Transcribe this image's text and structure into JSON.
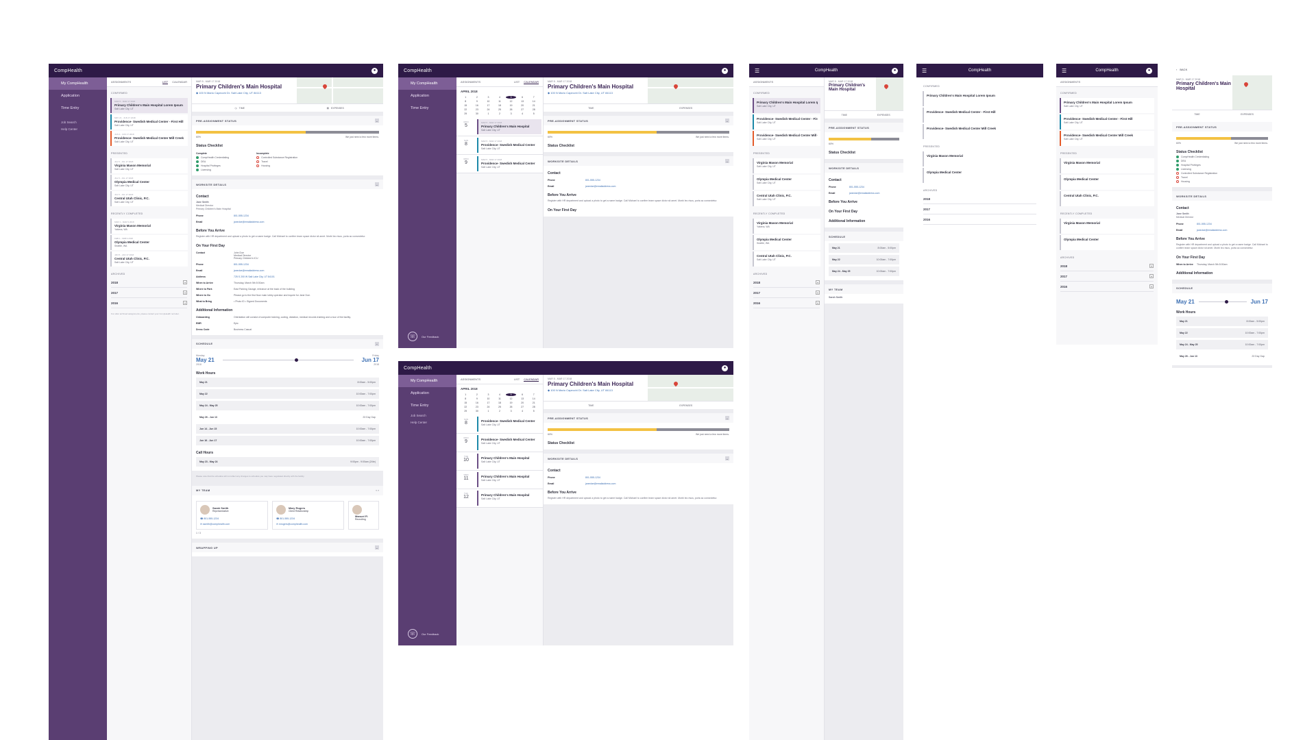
{
  "app": {
    "brand": "CompHealth"
  },
  "nav": {
    "items": [
      "My CompHealth",
      "Application",
      "Time Entry"
    ],
    "sub": [
      "Job Search",
      "Help Center"
    ],
    "contact": "Our Feedback"
  },
  "list": {
    "header": "ASSIGNMENTS",
    "tab_list": "LIST",
    "tab_calendar": "CALENDAR",
    "confirmed": "CONFIRMED",
    "presented": "PRESENTED",
    "recent": "RECENTLY COMPLETED",
    "archived": "ARCHIVED",
    "years": [
      "2018",
      "2017",
      "2016"
    ],
    "archive_note": "For older archived assignments, please contact your CompHealth recruiter.",
    "cards": [
      {
        "date": "MAR 5 - MAR 17 2018",
        "title": "Primary Children's Main Hospital Lorem Ipsum",
        "sub": "Salt Lake City, UT"
      },
      {
        "date": "MAY 21 - JUN 17 2018",
        "title": "Providence- Swedish Medical Center - First Hill",
        "sub": "Salt Lake City, UT"
      },
      {
        "date": "JUN 4 - JUN 17 2018",
        "title": "Providence- Swedish Medical Center Mill Creek",
        "sub": "Salt Lake City, UT"
      }
    ],
    "presented_cards": [
      {
        "date": "JUL 5 - JUL 17 2018",
        "title": "Virginia Mason Memorial",
        "sub": "Salt Lake City, UT"
      },
      {
        "date": "JUL 5 - JUL 17 2018",
        "title": "Olympia Medical Center",
        "sub": "Salt Lake City, UT"
      },
      {
        "date": "JUL 5 - JUL 17 2018",
        "title": "Central Utah Clinic, P.C.",
        "sub": "Salt Lake City, UT"
      }
    ],
    "recent_cards": [
      {
        "date": "MAR 1 - MAR 9 2018",
        "title": "Virginia Mason Memorial",
        "sub": "Yakima, WA"
      },
      {
        "date": "FEB 1 - FEB 9 2018",
        "title": "Olympia Medical Center",
        "sub": "Seattle, WA"
      },
      {
        "date": "JAN 5 - JAN 17 2018",
        "title": "Central Utah Clinic, P.C.",
        "sub": "Salt Lake City, UT"
      }
    ]
  },
  "detail": {
    "date": "MAR 5 - MAR 17 2018",
    "title": "Primary Children's Main Hospital",
    "address": "100 N Mario Capecchi Dr. Salt Lake City, UT 84113",
    "tab_time": "TIME",
    "tab_expenses": "EXPENSES",
    "pre_status": "PRE-ASSIGNMENT STATUS",
    "progress_label": "60%",
    "progress_value": 0.6,
    "progress_note": "We just need a few more items.",
    "checklist_title": "Status Checklist",
    "complete_label": "Complete",
    "incomplete_label": "Incomplete",
    "complete": [
      "CompHealth Credentialing",
      "DEA",
      "Hospital Privileges",
      "Licensing"
    ],
    "incomplete": [
      "Controlled Substance Registration",
      "Travel",
      "Housing"
    ],
    "worksite": "WORKSITE DETAILS",
    "contact_h": "Contact",
    "contact_name": "Jane Smith",
    "contact_role": "Medical Director",
    "contact_org": "Primary Children's Main Hospital",
    "phone_k": "Phone",
    "phone_v": "801-555-1234",
    "email_k": "Email",
    "email_v": "janedoe@emailaddress.com",
    "before_h": "Before You Arrive",
    "before_p": "Register with HR department and upload a photo to get a name badge. Call Michael to confirm team space dictor sit amet. Morbi leo risus, porta ac consectetur.",
    "first_h": "On Your First Day",
    "first_contact": "John Doe",
    "first_role": "Medical Director",
    "first_org": "Primary Children's ICU",
    "address_k": "Address",
    "address_v": "725 S 200 W Salt Lake City, UT 84101",
    "arrive_k": "When to Arrive",
    "arrive_v": "Thursday, March 5th 8:00am",
    "park_k": "Where to Park",
    "park_v": "East Parking Garage, entrance at the back of the building",
    "go_k": "Where to Go",
    "go_v": "Please go to the first floor main lobby operator and inquire for Jane Doe.",
    "bring_k": "What to Bring",
    "bring_v": "• Photo ID  • Signed Documents",
    "addl_h": "Additional Information",
    "onb_k": "Onboarding",
    "onb_v": "Orientation will consist of computer training, coding, dictation, medical records training and a tour of the facility.",
    "emr_k": "EMR",
    "emr_v": "Epic",
    "dress_k": "Dress Code",
    "dress_v": "Business Casual",
    "schedule": "SCHEDULE",
    "start_day": "Monday",
    "start": "May 21",
    "start_year": "2018",
    "end_day": "Friday",
    "end": "Jun 17",
    "end_year": "2018",
    "work_hours": "Work Hours",
    "rows": [
      {
        "d": "May 21",
        "h": "8:00am - 5:00pm"
      },
      {
        "d": "May 22",
        "h": "10:00am - 7:00pm"
      },
      {
        "d": "May 24 - May 25",
        "h": "10:00am - 7:00pm"
      },
      {
        "d": "May 26 - Jun 13",
        "h": "23 Day Gap"
      },
      {
        "d": "Jun 14 - Jun 15",
        "h": "10:00am - 7:00pm"
      },
      {
        "d": "Jun 16 - Jun 17",
        "h": "10:00am - 7:00pm"
      }
    ],
    "call_hours": "Call Hours",
    "call_row": {
      "d": "May 23 - May 24",
      "h": "9:00pm - 9:00am (24hr)"
    },
    "sched_note": "Please note that the schedule will not reflect any changes to schedule you may have negotiated directly with the facility.",
    "my_team": "MY TEAM",
    "team": [
      {
        "name": "Sarah Smith",
        "role": "Representative",
        "phone": "801-555-1234",
        "email": "ssmith@comphealth.com"
      },
      {
        "name": "Mary Rogers",
        "role": "Client Relationship",
        "phone": "801-555-1234",
        "email": "mrogers@comphealth.com"
      },
      {
        "name": "Manuel Fi",
        "role": "Recruiting",
        "phone": "801-555-1234",
        "email": "manuel@comphealth.com"
      }
    ],
    "pager": "1 / 3",
    "wrapping_up": "WRAPPING UP"
  },
  "calendar": {
    "month": "APRIL 2018",
    "days": [
      "1",
      "2",
      "3",
      "4",
      "5",
      "6",
      "7",
      "8",
      "9",
      "10",
      "11",
      "12",
      "13",
      "14",
      "15",
      "16",
      "17",
      "18",
      "19",
      "20",
      "21",
      "22",
      "23",
      "24",
      "25",
      "26",
      "27",
      "28",
      "29",
      "30",
      "1",
      "2",
      "3",
      "4",
      "5"
    ],
    "selected": "5",
    "agenda": [
      {
        "w": "MON",
        "n": "5"
      },
      {
        "w": "SUN",
        "n": "8"
      },
      {
        "w": "MON",
        "n": "9"
      },
      {
        "w": "TUE",
        "n": "10"
      },
      {
        "w": "WED",
        "n": "11"
      }
    ],
    "agenda2": [
      {
        "w": "SUN",
        "n": "8"
      },
      {
        "w": "MON",
        "n": "9"
      },
      {
        "w": "TUE",
        "n": "10"
      },
      {
        "w": "WED",
        "n": "11"
      },
      {
        "w": "THU",
        "n": "12"
      },
      {
        "w": "FRI",
        "n": "13"
      },
      {
        "w": "SAT",
        "n": "17"
      }
    ],
    "ev_title1": "Primary Children's Main Hospital",
    "ev_title2": "Providence- Swedish Medical Center",
    "ev_sub": "Salt Lake City, UT",
    "ev_date": "MAR 5 - MAR 17 2018"
  },
  "mobile": {
    "back": "BACK"
  },
  "colors": {
    "brand": "#2e1a47",
    "nav": "#5a3e72",
    "accent": "#3c6fb3",
    "progress": "#f3c243"
  }
}
